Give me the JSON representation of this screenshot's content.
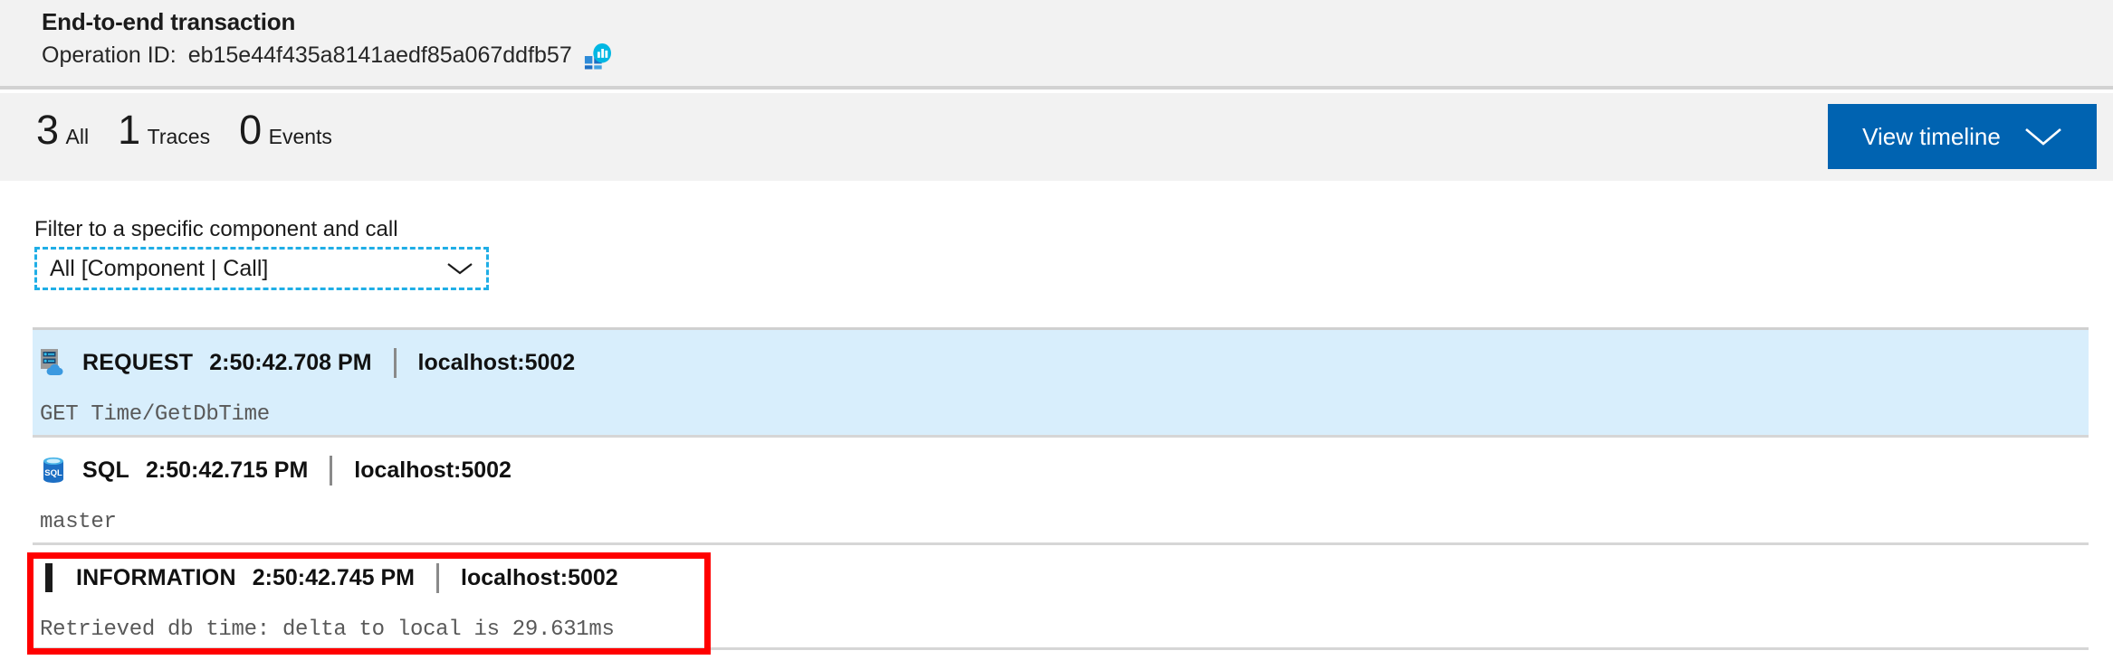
{
  "header": {
    "title": "End-to-end transaction",
    "operation_id_label": "Operation ID:",
    "operation_id": "eb15e44f435a8141aedf85a067ddfb57",
    "app_insights_icon": "application-insights-icon"
  },
  "stats": [
    {
      "value": "3",
      "label": "All"
    },
    {
      "value": "1",
      "label": "Traces"
    },
    {
      "value": "0",
      "label": "Events"
    }
  ],
  "toolbar": {
    "view_timeline_label": "View timeline",
    "view_timeline_icon": "chevron-down-icon",
    "accent_color": "#0063b1"
  },
  "filter": {
    "label": "Filter to a specific component and call",
    "selected": "All [Component | Call]",
    "chevron_icon": "chevron-down-icon",
    "focus_border_color": "#1faee6"
  },
  "events": [
    {
      "icon": "request-server-cloud-icon",
      "kind": "REQUEST",
      "time": "2:50:42.708 PM",
      "host": "localhost:5002",
      "detail": "GET Time/GetDbTime",
      "selected": true
    },
    {
      "icon": "sql-database-icon",
      "kind": "SQL",
      "time": "2:50:42.715 PM",
      "host": "localhost:5002",
      "detail": "master",
      "selected": false
    },
    {
      "icon": "information-bar-icon",
      "kind": "INFORMATION",
      "time": "2:50:42.745 PM",
      "host": "localhost:5002",
      "detail": "Retrieved db time: delta to local is 29.631ms",
      "selected": false
    }
  ],
  "annotation": {
    "color": "#ff0000",
    "target": "information-event-row"
  }
}
